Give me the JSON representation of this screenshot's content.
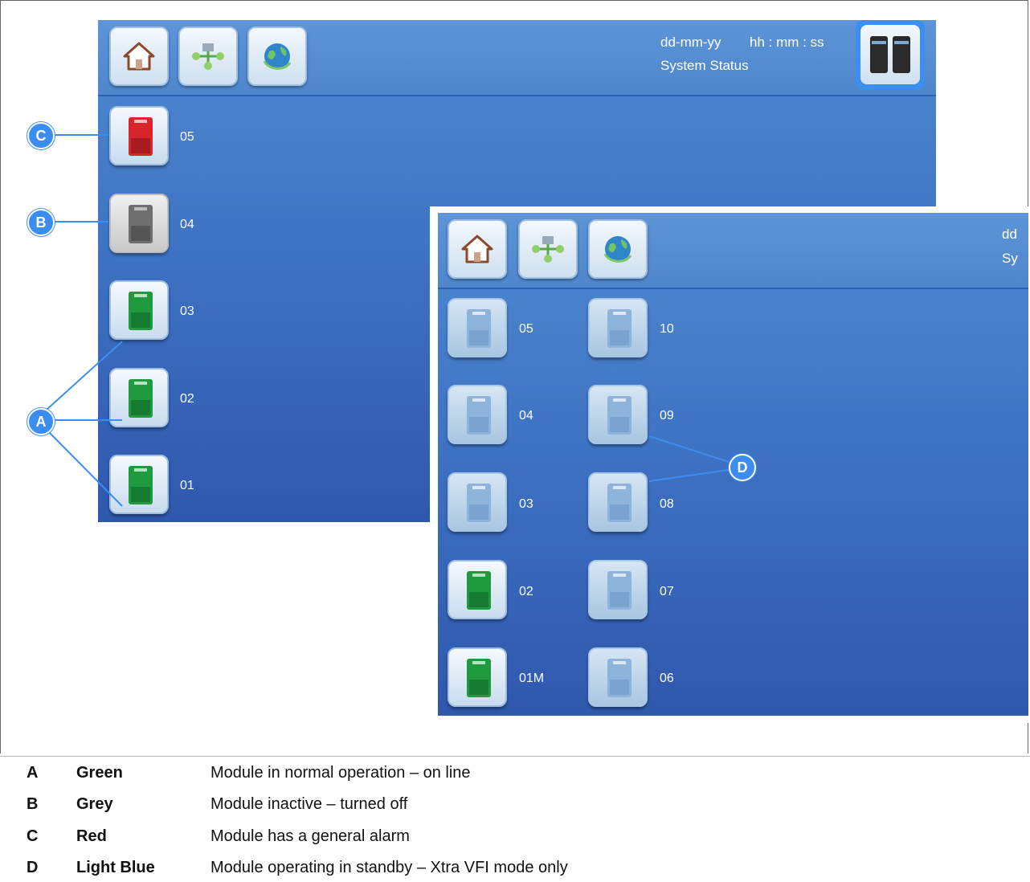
{
  "screen1": {
    "date_text": "dd-mm-yy",
    "time_text": "hh : mm : ss",
    "status_text": "System Status",
    "modules": [
      {
        "label": "05",
        "state": "alarm",
        "color": "#d6262b"
      },
      {
        "label": "04",
        "state": "inactive",
        "color": "#6f6f6f"
      },
      {
        "label": "03",
        "state": "normal",
        "color": "#1f9a3e"
      },
      {
        "label": "02",
        "state": "normal",
        "color": "#1f9a3e"
      },
      {
        "label": "01",
        "state": "normal",
        "color": "#1f9a3e"
      }
    ]
  },
  "screen2": {
    "date_text": "dd",
    "status_text": "Sy",
    "modules_left": [
      {
        "label": "05",
        "state": "standby"
      },
      {
        "label": "04",
        "state": "standby"
      },
      {
        "label": "03",
        "state": "standby"
      },
      {
        "label": "02",
        "state": "normal"
      },
      {
        "label": "01M",
        "state": "normal"
      }
    ],
    "modules_right": [
      {
        "label": "10",
        "state": "standby"
      },
      {
        "label": "09",
        "state": "standby"
      },
      {
        "label": "08",
        "state": "standby"
      },
      {
        "label": "07",
        "state": "standby"
      },
      {
        "label": "06",
        "state": "standby"
      }
    ]
  },
  "callouts": [
    "A",
    "B",
    "C",
    "D"
  ],
  "legend": [
    {
      "key": "A",
      "color_name": "Green",
      "description": "Module in normal operation – on line"
    },
    {
      "key": "B",
      "color_name": "Grey",
      "description": "Module inactive – turned off"
    },
    {
      "key": "C",
      "color_name": "Red",
      "description": "Module has a general alarm"
    },
    {
      "key": "D",
      "color_name": "Light Blue",
      "description": "Module operating in standby – Xtra VFI mode only"
    }
  ],
  "icons": [
    "home-icon",
    "network-icon",
    "globe-icon",
    "system-status-icon",
    "ups-module-icon"
  ],
  "colors": {
    "accent": "#3b8ef0",
    "normal": "#1f9a3e",
    "alarm": "#d6262b",
    "inactive": "#6f6f6f",
    "standby": "#8fb4dc"
  }
}
